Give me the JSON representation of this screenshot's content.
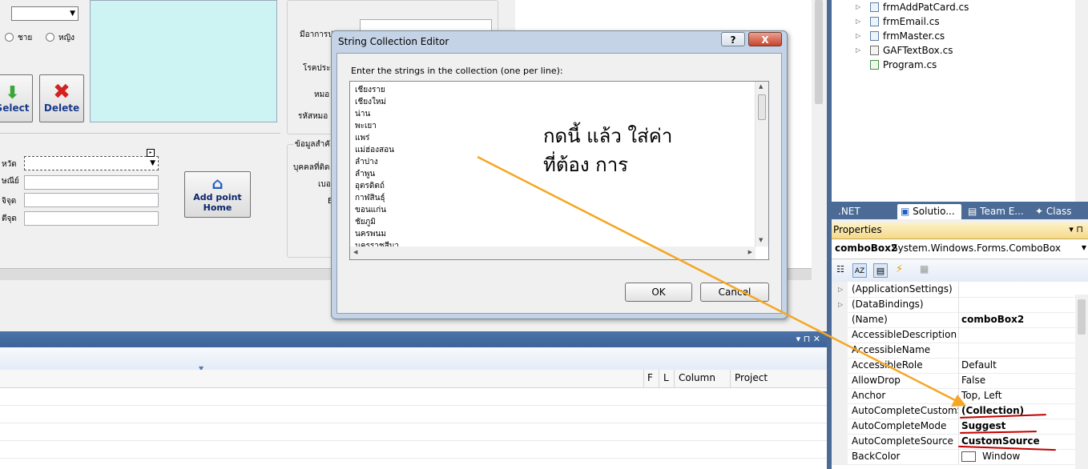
{
  "designer": {
    "gender_male": "ชาย",
    "gender_female": "หญิง",
    "select_button": "Select",
    "delete_button": "Delete",
    "add_point_home_line1": "Add point",
    "add_point_home_line2": "Home",
    "label_province": "หวัด",
    "label_phone": "ษณีย์",
    "label_point1": "จิจุด",
    "label_point2": "ตีจุด",
    "label_symptom": "มีอาการป",
    "label_disease": "โรคประ",
    "label_doctor": "หมอ",
    "label_doctor_code": "รหัสหมอ",
    "group_important": "ข้อมูลสำคั",
    "label_contact": "บุคคลที่ติด",
    "label_number": "เบอ",
    "label_e": "E"
  },
  "dialog": {
    "title": "String Collection Editor",
    "help_label": "?",
    "close_label": "X",
    "instruction": "Enter the strings in the collection (one per line):",
    "strings": [
      "เชียงราย",
      "เชียงใหม่",
      "น่าน",
      "พะเยา",
      "แพร่",
      "แม่ฮ่องสอน",
      "ลำปาง",
      "ลำพูน",
      "อุตรดิตถ์",
      "กาฬสินธุ์",
      "ขอนแก่น",
      "ชัยภูมิ",
      "นครพนม",
      "นครราชสีมา"
    ],
    "ok_label": "OK",
    "cancel_label": "Cancel"
  },
  "annotation": {
    "line1": "กดนี้ แล้ว ใส่ค่า",
    "line2": "ที่ต้อง การ",
    "arrow_color": "#f5a623"
  },
  "error_list": {
    "columns": [
      "F",
      "L",
      "Column",
      "Project"
    ],
    "pin_label": "▾ ⊓ ✕"
  },
  "solution_explorer": {
    "items": [
      "frmAddPatCard.cs",
      "frmEmail.cs",
      "frmMaster.cs",
      "GAFTextBox.cs",
      "Program.cs"
    ]
  },
  "tabs": [
    ".NET Refle...",
    "Solutio...",
    "Team E...",
    "Class Vi..."
  ],
  "properties": {
    "header": "Properties",
    "object_name": "comboBox2",
    "object_type": "System.Windows.Forms.ComboBox",
    "rows": [
      {
        "name": "(ApplicationSettings)",
        "value": ""
      },
      {
        "name": "(DataBindings)",
        "value": ""
      },
      {
        "name": "(Name)",
        "value": "comboBox2"
      },
      {
        "name": "AccessibleDescription",
        "value": ""
      },
      {
        "name": "AccessibleName",
        "value": ""
      },
      {
        "name": "AccessibleRole",
        "value": "Default"
      },
      {
        "name": "AllowDrop",
        "value": "False"
      },
      {
        "name": "Anchor",
        "value": "Top, Left"
      },
      {
        "name": "AutoCompleteCustomSource",
        "value": "(Collection)"
      },
      {
        "name": "AutoCompleteMode",
        "value": "Suggest"
      },
      {
        "name": "AutoCompleteSource",
        "value": "CustomSource"
      },
      {
        "name": "BackColor",
        "value": "Window"
      }
    ]
  }
}
